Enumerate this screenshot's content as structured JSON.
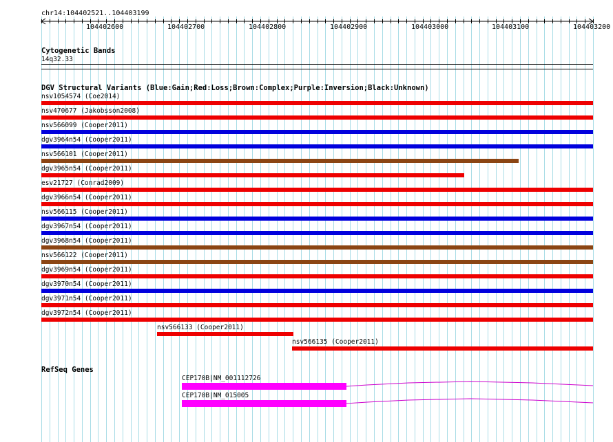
{
  "ruler": {
    "location": "chr14:104402521..104403199",
    "ticks": [
      "104402600",
      "104402700",
      "104402800",
      "104402900",
      "104403000",
      "104403100",
      "104403200"
    ]
  },
  "cytoband": {
    "title": "Cytogenetic Bands",
    "band": "14q32.33"
  },
  "dgv": {
    "title": "DGV Structural Variants (Blue:Gain;Red:Loss;Brown:Complex;Purple:Inversion;Black:Unknown)",
    "colors": {
      "gain": "#0000dd",
      "loss": "#ee0000",
      "complex": "#8b4513"
    },
    "variants": [
      {
        "label": "nsv1054574 (Coe2014)",
        "type": "loss"
      },
      {
        "label": "nsv470677 (Jakobsson2008)",
        "type": "loss"
      },
      {
        "label": "nsv566099 (Cooper2011)",
        "type": "gain"
      },
      {
        "label": "dgv3964n54 (Cooper2011)",
        "type": "gain"
      },
      {
        "label": "nsv566101 (Cooper2011)",
        "type": "complex"
      },
      {
        "label": "dgv3965n54 (Cooper2011)",
        "type": "loss"
      },
      {
        "label": "esv21727 (Conrad2009)",
        "type": "loss"
      },
      {
        "label": "dgv3966n54 (Cooper2011)",
        "type": "loss"
      },
      {
        "label": "nsv566115 (Cooper2011)",
        "type": "gain"
      },
      {
        "label": "dgv3967n54 (Cooper2011)",
        "type": "gain"
      },
      {
        "label": "dgv3968n54 (Cooper2011)",
        "type": "complex"
      },
      {
        "label": "nsv566122 (Cooper2011)",
        "type": "complex"
      },
      {
        "label": "dgv3969n54 (Cooper2011)",
        "type": "loss"
      },
      {
        "label": "dgv3970n54 (Cooper2011)",
        "type": "gain"
      },
      {
        "label": "dgv3971n54 (Cooper2011)",
        "type": "loss"
      },
      {
        "label": "dgv3972n54 (Cooper2011)",
        "type": "loss"
      },
      {
        "label": "nsv566133 (Cooper2011)",
        "type": "loss"
      },
      {
        "label": "nsv566135 (Cooper2011)",
        "type": "loss"
      }
    ]
  },
  "refseq": {
    "title": "RefSeq Genes",
    "gene_color": "#ff00ff",
    "genes": [
      {
        "label": "CEP170B|NM_001112726"
      },
      {
        "label": "CEP170B|NM_015005"
      }
    ]
  }
}
